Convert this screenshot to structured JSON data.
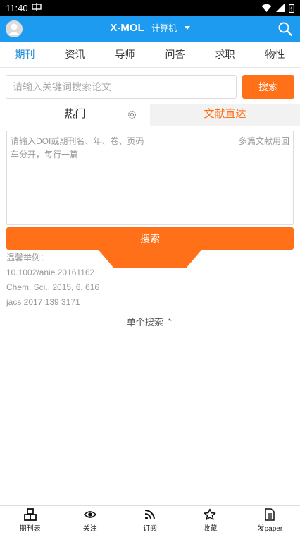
{
  "status_bar": {
    "time": "11:40",
    "notification_icon": "app-notification-icon",
    "icons": [
      "wifi-icon",
      "signal-icon",
      "battery-icon"
    ]
  },
  "header": {
    "title": "X-MOL",
    "category": "计算机",
    "accent": "#1c9bf0"
  },
  "tabs": [
    {
      "label": "期刊",
      "active": true
    },
    {
      "label": "资讯",
      "active": false
    },
    {
      "label": "导师",
      "active": false
    },
    {
      "label": "问答",
      "active": false
    },
    {
      "label": "求职",
      "active": false
    },
    {
      "label": "物性",
      "active": false
    }
  ],
  "search": {
    "placeholder": "请输入关键词搜索论文",
    "button_label": "搜索",
    "button_color": "#ff7019"
  },
  "subtabs": {
    "hot": "热门",
    "doi": "文献直达"
  },
  "doi": {
    "placeholder_line1": "请输入DOI或期刊名、年、卷、页码",
    "placeholder_line2": "车分开，每行一篇",
    "tip": "多篇文献用回",
    "search_label": "搜索"
  },
  "examples": {
    "title": "温馨举例：",
    "items": [
      "10.1002/anie.20161162",
      "Chem. Sci., 2015, 6, 616",
      "jacs 2017 139 3171"
    ]
  },
  "single_search": "单个搜索 ⌃",
  "bottom_nav": [
    {
      "label": "期刊表",
      "icon": "cubes-icon"
    },
    {
      "label": "关注",
      "icon": "eye-icon"
    },
    {
      "label": "订阅",
      "icon": "rss-icon"
    },
    {
      "label": "收藏",
      "icon": "star-icon"
    },
    {
      "label": "发paper",
      "icon": "document-icon"
    }
  ]
}
